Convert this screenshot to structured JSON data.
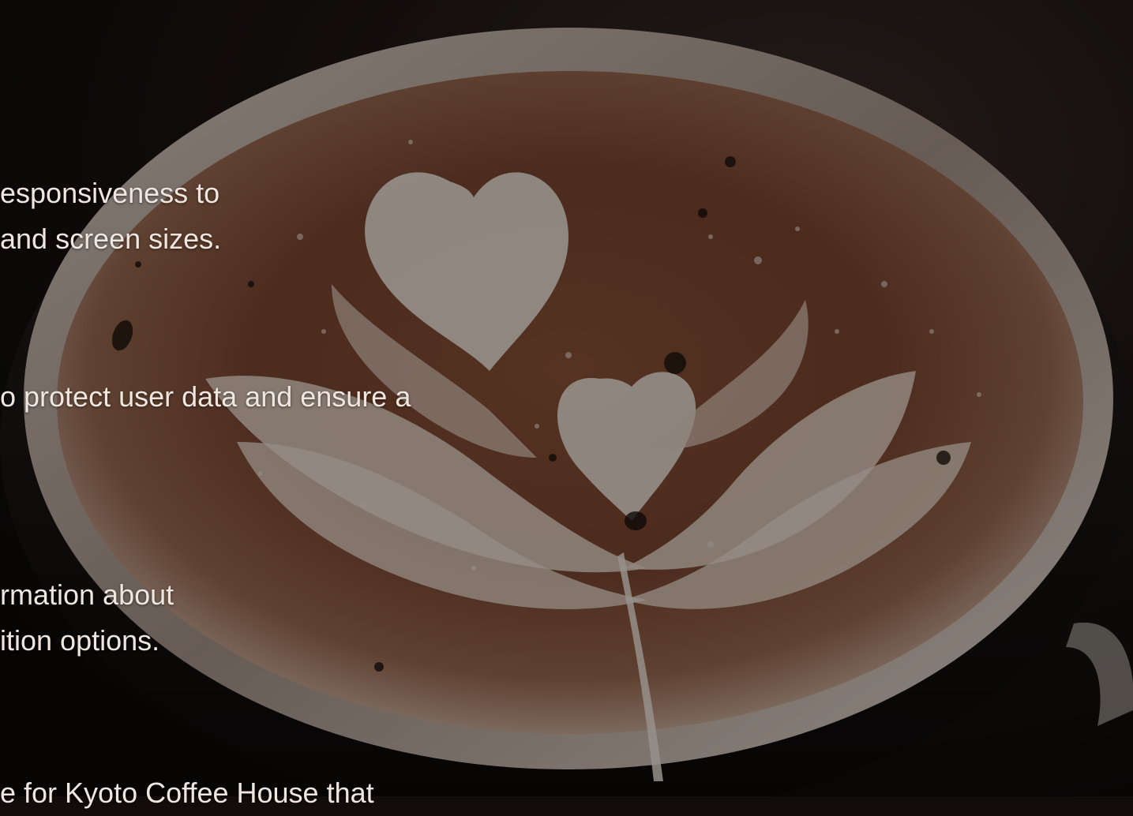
{
  "slide": {
    "background_image": "latte-art-coffee-cup-photo",
    "overlay_color": "#000000",
    "text_color": "#efe7df",
    "text_blocks": [
      {
        "lines": [
          "esponsiveness to",
          " and screen sizes."
        ]
      },
      {
        "lines": [
          "o protect user data and ensure a"
        ]
      },
      {
        "lines": [
          "rmation about",
          "ition options."
        ]
      },
      {
        "lines": [
          "e for Kyoto Coffee House that"
        ]
      }
    ]
  }
}
